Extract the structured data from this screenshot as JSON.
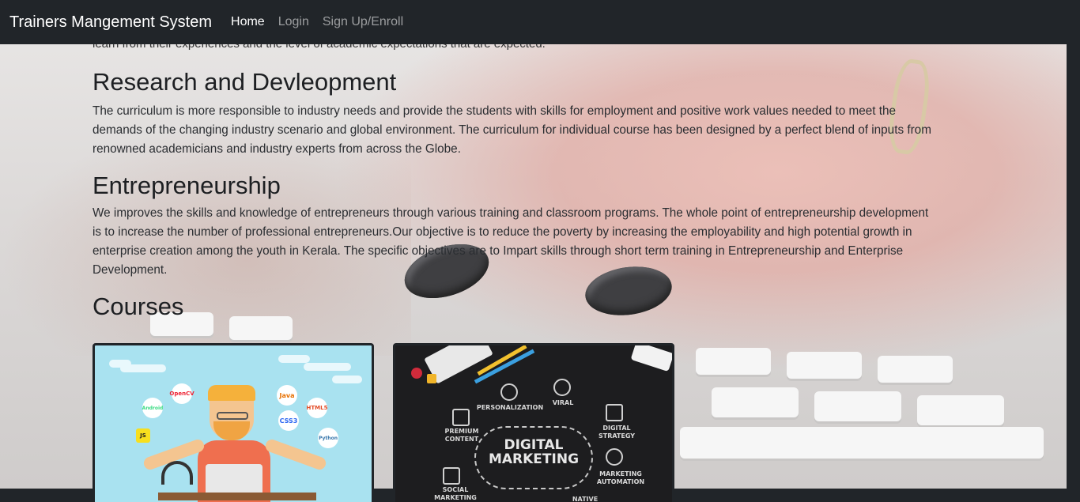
{
  "navbar": {
    "brand": "Trainers Mangement System",
    "links": [
      "Home",
      "Login",
      "Sign Up/Enroll"
    ]
  },
  "content": {
    "cut_text": "learn from their experiences and the level of academic expectations that are expected.",
    "sections": [
      {
        "heading": "Research and Devleopment",
        "lines": [
          "The curriculum is more responsible to industry needs and provide the students with skills for employment and positive work values needed to meet the",
          "demands of the changing industry scenario and global environment. The curriculum for individual course has been designed by a perfect blend of inputs from",
          "renowned academicians and industry experts from across the Globe."
        ]
      },
      {
        "heading": "Entrepreneurship",
        "lines": [
          "We improves the skills and knowledge of entrepreneurs through various training and classroom programs. The whole point of entrepreneurship development",
          "is to increase the number of professional entrepreneurs.Our objective is to reduce the poverty by increasing the employability and high potential growth in",
          "enterprise creation among the youth in Kerala. The specific objectives are to Impart skills through short term training in Entrepreneurship and Enterprise",
          "Development."
        ]
      }
    ],
    "courses_heading": "Courses"
  },
  "cards": [
    {
      "name": "programming-course",
      "icons": [
        "OpenCV",
        "Java",
        "HTML5",
        "CSS3",
        "Python",
        "Android",
        "JS"
      ]
    },
    {
      "name": "digital-marketing-course",
      "title_line1": "DIGITAL",
      "title_line2": "MARKETING",
      "labels": [
        "PERSONALIZATION",
        "VIRAL",
        "PREMIUM CONTENT",
        "DIGITAL STRATEGY",
        "MARKETING AUTOMATION",
        "SOCIAL MARKETING",
        "NATIVE"
      ]
    }
  ],
  "colors": {
    "navbar": "#212529",
    "link_active": "#ffffff",
    "link_muted": "#8c8f93"
  }
}
